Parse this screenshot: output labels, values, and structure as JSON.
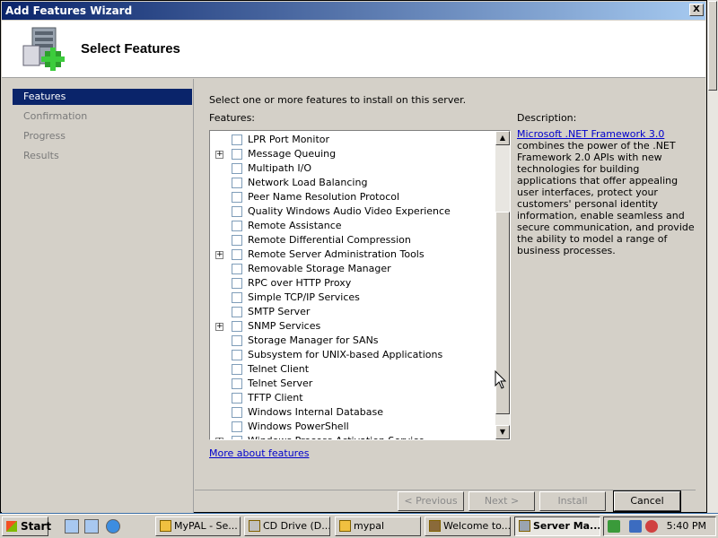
{
  "window": {
    "title": "Add Features Wizard",
    "close_glyph": "X"
  },
  "header": {
    "title": "Select Features",
    "icon": "server-add-icon"
  },
  "nav": {
    "items": [
      {
        "label": "Features",
        "active": true
      },
      {
        "label": "Confirmation",
        "active": false
      },
      {
        "label": "Progress",
        "active": false
      },
      {
        "label": "Results",
        "active": false
      }
    ]
  },
  "content": {
    "intro": "Select one or more features to install on this server.",
    "features_label": "Features:",
    "description_label": "Description:",
    "description_link": "Microsoft .NET Framework 3.0",
    "description_text": "combines the power of the .NET Framework 2.0 APIs with new technologies for building applications that offer appealing user interfaces, protect your customers' personal identity information, enable seamless and secure communication, and provide the ability to model a range of business processes.",
    "more_link": "More about features",
    "features": [
      {
        "label": "LPR Port Monitor",
        "expandable": false,
        "checked": false
      },
      {
        "label": "Message Queuing",
        "expandable": true,
        "checked": false
      },
      {
        "label": "Multipath I/O",
        "expandable": false,
        "checked": false
      },
      {
        "label": "Network Load Balancing",
        "expandable": false,
        "checked": false
      },
      {
        "label": "Peer Name Resolution Protocol",
        "expandable": false,
        "checked": false
      },
      {
        "label": "Quality Windows Audio Video Experience",
        "expandable": false,
        "checked": false
      },
      {
        "label": "Remote Assistance",
        "expandable": false,
        "checked": false
      },
      {
        "label": "Remote Differential Compression",
        "expandable": false,
        "checked": false
      },
      {
        "label": "Remote Server Administration Tools",
        "expandable": true,
        "checked": false
      },
      {
        "label": "Removable Storage Manager",
        "expandable": false,
        "checked": false
      },
      {
        "label": "RPC over HTTP Proxy",
        "expandable": false,
        "checked": false
      },
      {
        "label": "Simple TCP/IP Services",
        "expandable": false,
        "checked": false
      },
      {
        "label": "SMTP Server",
        "expandable": false,
        "checked": false
      },
      {
        "label": "SNMP Services",
        "expandable": true,
        "checked": false
      },
      {
        "label": "Storage Manager for SANs",
        "expandable": false,
        "checked": false
      },
      {
        "label": "Subsystem for UNIX-based Applications",
        "expandable": false,
        "checked": false
      },
      {
        "label": "Telnet Client",
        "expandable": false,
        "checked": false
      },
      {
        "label": "Telnet Server",
        "expandable": false,
        "checked": false
      },
      {
        "label": "TFTP Client",
        "expandable": false,
        "checked": false
      },
      {
        "label": "Windows Internal Database",
        "expandable": false,
        "checked": false
      },
      {
        "label": "Windows PowerShell",
        "expandable": false,
        "checked": false
      },
      {
        "label": "Windows Process Activation Service",
        "expandable": true,
        "checked": false
      }
    ]
  },
  "buttons": {
    "previous": "< Previous",
    "next": "Next >",
    "install": "Install",
    "cancel": "Cancel"
  },
  "taskbar": {
    "start": "Start",
    "tasks": [
      {
        "label": "MyPAL - Se...",
        "active": false
      },
      {
        "label": "CD Drive (D...",
        "active": false
      },
      {
        "label": "mypal",
        "active": false
      },
      {
        "label": "Welcome to...",
        "active": false
      },
      {
        "label": "Server Ma...",
        "active": true
      }
    ],
    "clock": "5:40 PM"
  }
}
